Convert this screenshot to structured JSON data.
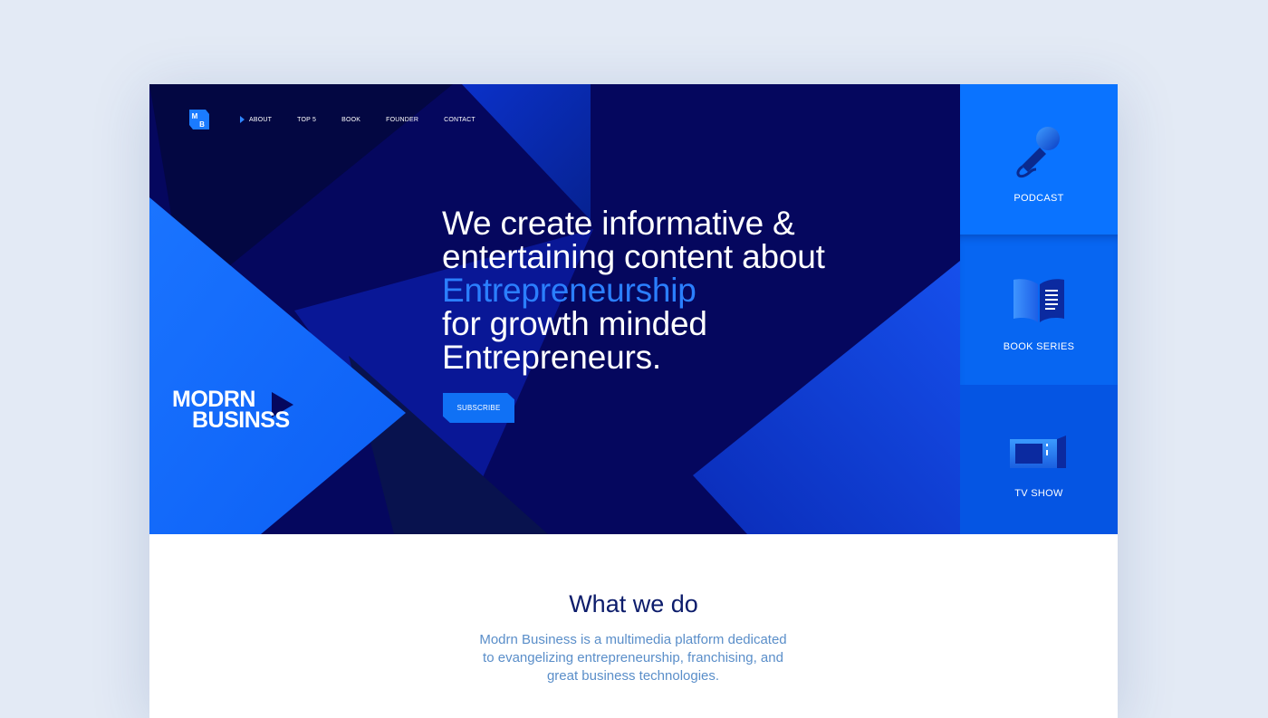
{
  "nav": {
    "logo_text": "MB",
    "items": [
      {
        "label": "About",
        "active": true
      },
      {
        "label": "Top 5",
        "active": false
      },
      {
        "label": "Book",
        "active": false
      },
      {
        "label": "Founder",
        "active": false
      },
      {
        "label": "Contact",
        "active": false
      }
    ]
  },
  "brand": {
    "line1": "MODRN",
    "line2": "BUSINSS"
  },
  "hero": {
    "line1": "We create informative &",
    "line2": "entertaining content about",
    "accent": "Entrepreneurship",
    "line4": "for growth minded",
    "line5": "Entrepreneurs.",
    "cta": "Subscribe"
  },
  "sidebar": {
    "tiles": [
      {
        "label": "PODCAST",
        "icon": "microphone-icon"
      },
      {
        "label": "BOOK SERIES",
        "icon": "book-icon"
      },
      {
        "label": "TV SHOW",
        "icon": "tv-icon"
      }
    ]
  },
  "about": {
    "title": "What we do",
    "line1": "Modrn Business is a multimedia platform dedicated",
    "line2": "to evangelizing entrepreneurship, franchising, and",
    "line3": "great business technologies."
  },
  "colors": {
    "page_bg": "#e3eaf5",
    "hero_dark": "#05075e",
    "accent_blue": "#2b7fff",
    "tile_podcast": "#0a73ff",
    "tile_book": "#0766f2",
    "tile_tv": "#0555e3",
    "title_navy": "#0c1c6b",
    "body_blue": "#5a8ec9"
  }
}
